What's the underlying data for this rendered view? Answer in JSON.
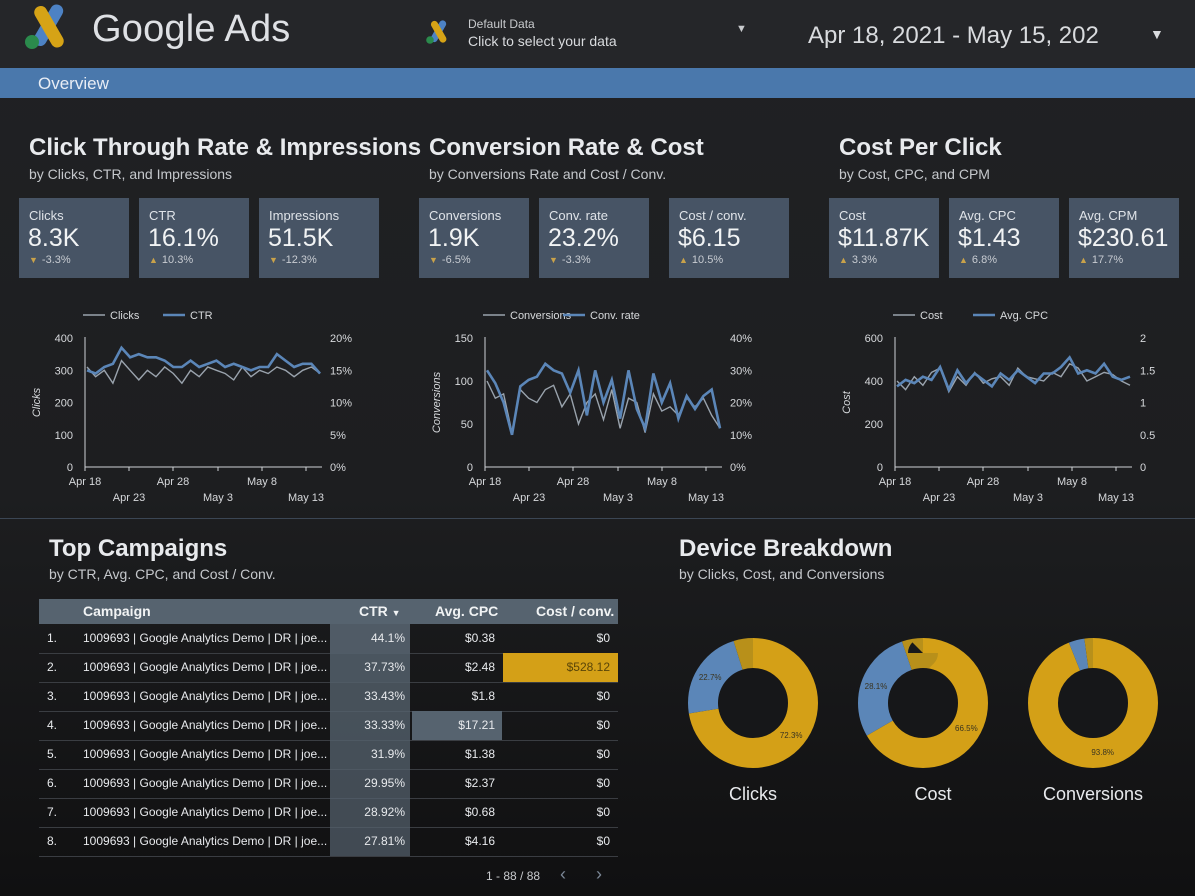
{
  "header": {
    "title": "Google Ads",
    "data_source": {
      "name": "Default Data",
      "hint": "Click to select your data"
    },
    "date_range": "Apr 18, 2021 - May 15, 202",
    "nav": {
      "overview": "Overview"
    }
  },
  "colors": {
    "accent_blue": "#5b86b8",
    "accent_gold": "#d4a017",
    "card": "#475465",
    "nav": "#4a78ac"
  },
  "sections": [
    {
      "title": "Click Through Rate & Impressions",
      "subtitle": "by Clicks, CTR, and Impressions",
      "kpis": [
        {
          "label": "Clicks",
          "value": "8.3K",
          "delta": "-3.3%"
        },
        {
          "label": "CTR",
          "value": "16.1%",
          "delta": "10.3%"
        },
        {
          "label": "Impressions",
          "value": "51.5K",
          "delta": "-12.3%"
        }
      ]
    },
    {
      "title": "Conversion Rate & Cost",
      "subtitle": "by Conversions Rate and Cost / Conv.",
      "kpis": [
        {
          "label": "Conversions",
          "value": "1.9K",
          "delta": "-6.5%"
        },
        {
          "label": "Conv. rate",
          "value": "23.2%",
          "delta": "-3.3%"
        },
        {
          "label": "Cost / conv.",
          "value": "$6.15",
          "delta": "10.5%"
        }
      ]
    },
    {
      "title": "Cost Per Click",
      "subtitle": "by Cost, CPC, and CPM",
      "kpis": [
        {
          "label": "Cost",
          "value": "$11.87K",
          "delta": "3.3%"
        },
        {
          "label": "Avg. CPC",
          "value": "$1.43",
          "delta": "6.8%"
        },
        {
          "label": "Avg. CPM",
          "value": "$230.61",
          "delta": "17.7%"
        }
      ]
    }
  ],
  "chart_data": [
    {
      "type": "line",
      "x_ticks_top": [
        "Apr 18",
        "Apr 28",
        "May 8"
      ],
      "x_ticks_bottom": [
        "Apr 23",
        "May 3",
        "May 13"
      ],
      "ylabel_left": "Clicks",
      "ylabel_right": "CTR",
      "yticks_left": [
        "400",
        "300",
        "200",
        "100",
        "0"
      ],
      "yticks_right": [
        "20%",
        "15%",
        "10%",
        "5%",
        "0%"
      ],
      "ylim_left": [
        0,
        400
      ],
      "ylim_right": [
        0,
        20
      ],
      "series": [
        {
          "name": "Clicks",
          "axis": "left",
          "values": [
            310,
            280,
            300,
            260,
            330,
            300,
            270,
            300,
            280,
            310,
            290,
            260,
            300,
            280,
            310,
            300,
            290,
            270,
            310,
            280,
            300,
            290,
            310,
            300,
            280,
            300,
            310,
            290
          ]
        },
        {
          "name": "CTR",
          "axis": "right",
          "values": [
            15,
            14.5,
            15.5,
            16,
            18.5,
            17,
            17.5,
            17,
            17,
            16.5,
            15.5,
            15.5,
            16.5,
            15.5,
            16,
            16.5,
            15.5,
            16,
            15.5,
            15,
            15.5,
            15.5,
            17.5,
            16.5,
            15.5,
            16,
            16,
            14.5
          ]
        }
      ]
    },
    {
      "type": "line",
      "x_ticks_top": [
        "Apr 18",
        "Apr 28",
        "May 8"
      ],
      "x_ticks_bottom": [
        "Apr 23",
        "May 3",
        "May 13"
      ],
      "ylabel_left": "Conversions",
      "ylabel_right": "Conv. rate",
      "yticks_left": [
        "150",
        "100",
        "50",
        "0"
      ],
      "yticks_right": [
        "40%",
        "30%",
        "20%",
        "10%",
        "0%"
      ],
      "ylim_left": [
        0,
        150
      ],
      "ylim_right": [
        0,
        40
      ],
      "series": [
        {
          "name": "Conversions",
          "axis": "left",
          "values": [
            100,
            80,
            85,
            40,
            90,
            80,
            75,
            90,
            95,
            70,
            85,
            50,
            75,
            85,
            55,
            90,
            45,
            80,
            75,
            40,
            85,
            65,
            70,
            60,
            80,
            70,
            80,
            60,
            45
          ]
        },
        {
          "name": "Conv. rate",
          "axis": "right",
          "values": [
            30,
            26,
            20,
            10,
            25,
            27,
            28,
            32,
            30,
            29,
            23,
            30,
            16,
            30,
            20,
            27,
            15,
            30,
            18,
            12,
            29,
            20,
            26,
            15,
            22,
            18,
            22,
            24,
            12
          ]
        }
      ]
    },
    {
      "type": "line",
      "x_ticks_top": [
        "Apr 18",
        "Apr 28",
        "May 8"
      ],
      "x_ticks_bottom": [
        "Apr 23",
        "May 3",
        "May 13"
      ],
      "ylabel_left": "Cost",
      "ylabel_right": "Avg. CPC",
      "yticks_left": [
        "600",
        "400",
        "200",
        "0"
      ],
      "yticks_right": [
        "2",
        "1.5",
        "1",
        "0.5",
        "0"
      ],
      "ylim_left": [
        0,
        600
      ],
      "ylim_right": [
        0,
        2
      ],
      "series": [
        {
          "name": "Cost",
          "axis": "left",
          "values": [
            400,
            360,
            420,
            380,
            440,
            460,
            350,
            420,
            380,
            440,
            390,
            410,
            420,
            380,
            460,
            420,
            410,
            400,
            440,
            420,
            480,
            460,
            400,
            420,
            440,
            430,
            400,
            380
          ]
        },
        {
          "name": "Avg. CPC",
          "axis": "right",
          "values": [
            1.25,
            1.35,
            1.3,
            1.4,
            1.35,
            1.55,
            1.2,
            1.5,
            1.3,
            1.45,
            1.35,
            1.25,
            1.45,
            1.35,
            1.5,
            1.4,
            1.3,
            1.45,
            1.45,
            1.55,
            1.7,
            1.45,
            1.5,
            1.45,
            1.6,
            1.4,
            1.35,
            1.4
          ]
        }
      ]
    },
    {
      "type": "pie",
      "title": "Clicks",
      "slices": [
        {
          "color": "#d4a017",
          "value": 72.3,
          "label": "72.3%"
        },
        {
          "color": "#5b86b8",
          "value": 22.7,
          "label": "22.7%"
        },
        {
          "color": "#b8901a",
          "value": 5.0,
          "label": ""
        }
      ]
    },
    {
      "type": "pie",
      "title": "Cost",
      "slices": [
        {
          "color": "#d4a017",
          "value": 66.5,
          "label": "66.5%"
        },
        {
          "color": "#5b86b8",
          "value": 28.1,
          "label": "28.1%"
        },
        {
          "color": "#b8901a",
          "value": 5.4,
          "label": ""
        }
      ]
    },
    {
      "type": "pie",
      "title": "Conversions",
      "slices": [
        {
          "color": "#d4a017",
          "value": 93.8,
          "label": "93.8%"
        },
        {
          "color": "#5b86b8",
          "value": 3.9,
          "label": ""
        },
        {
          "color": "#b8901a",
          "value": 2.3,
          "label": ""
        }
      ]
    }
  ],
  "campaigns": {
    "title": "Top Campaigns",
    "subtitle": "by CTR, Avg. CPC, and Cost / Conv.",
    "columns": [
      "Campaign",
      "CTR",
      "Avg. CPC",
      "Cost / conv."
    ],
    "sort_indicator": "▼",
    "rows": [
      {
        "n": "1.",
        "campaign": "1009693 | Google Analytics Demo | DR | joe...",
        "ctr": "44.1%",
        "cpc": "$0.38",
        "cost_conv": "$0"
      },
      {
        "n": "2.",
        "campaign": "1009693 | Google Analytics Demo | DR | joe...",
        "ctr": "37.73%",
        "cpc": "$2.48",
        "cost_conv": "$528.12"
      },
      {
        "n": "3.",
        "campaign": "1009693 | Google Analytics Demo | DR | joe...",
        "ctr": "33.43%",
        "cpc": "$1.8",
        "cost_conv": "$0"
      },
      {
        "n": "4.",
        "campaign": "1009693 | Google Analytics Demo | DR | joe...",
        "ctr": "33.33%",
        "cpc": "$17.21",
        "cost_conv": "$0"
      },
      {
        "n": "5.",
        "campaign": "1009693 | Google Analytics Demo | DR | joe...",
        "ctr": "31.9%",
        "cpc": "$1.38",
        "cost_conv": "$0"
      },
      {
        "n": "6.",
        "campaign": "1009693 | Google Analytics Demo | DR | joe...",
        "ctr": "29.95%",
        "cpc": "$2.37",
        "cost_conv": "$0"
      },
      {
        "n": "7.",
        "campaign": "1009693 | Google Analytics Demo | DR | joe...",
        "ctr": "28.92%",
        "cpc": "$0.68",
        "cost_conv": "$0"
      },
      {
        "n": "8.",
        "campaign": "1009693 | Google Analytics Demo | DR | joe...",
        "ctr": "27.81%",
        "cpc": "$4.16",
        "cost_conv": "$0"
      }
    ],
    "pager": "1 - 88 / 88"
  },
  "devices": {
    "title": "Device Breakdown",
    "subtitle": "by Clicks, Cost, and Conversions"
  },
  "icons": {
    "picker_caret": "caret-down-icon",
    "prev": "chevron-left-icon",
    "next": "chevron-right-icon"
  }
}
